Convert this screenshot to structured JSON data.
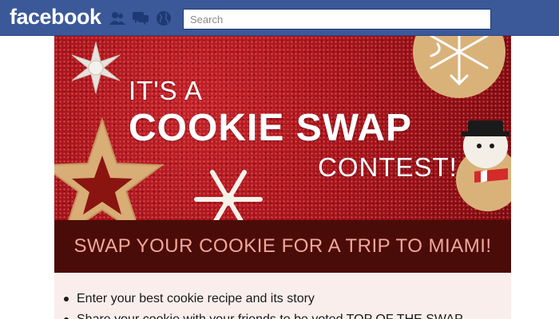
{
  "topbar": {
    "logo": "facebook",
    "search": {
      "placeholder": "Search",
      "value": ""
    },
    "icons": [
      "friend-requests-icon",
      "messages-icon",
      "notifications-globe-icon"
    ],
    "colors": {
      "bar": "#3b5998"
    }
  },
  "hero": {
    "line1": "IT'S A",
    "line2": "COOKIE SWAP",
    "line3": "CONTEST!",
    "colors": {
      "background": "#a8151c"
    }
  },
  "tagline": {
    "text": "SWAP YOUR COOKIE FOR A TRIP TO MIAMI!",
    "colors": {
      "background": "#4a0c08",
      "text": "#f2a79a"
    }
  },
  "content": {
    "bullets": [
      "Enter your best cookie recipe and its story",
      "Share your cookie with your friends to be voted TOP OF THE SWAP"
    ]
  }
}
